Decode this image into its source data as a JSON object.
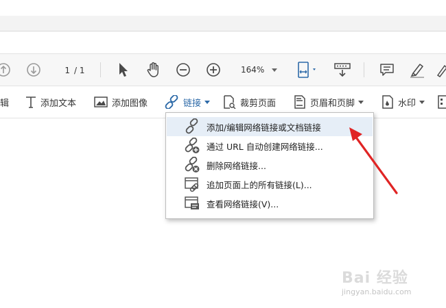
{
  "nav": {
    "page_current": "1",
    "page_total": "/ 1",
    "zoom": "164%"
  },
  "edit_toolbar": {
    "partial_label": "辑",
    "add_text": "添加文本",
    "add_image": "添加图像",
    "link": "链接",
    "crop_page": "裁剪页面",
    "header_footer": "页眉和页脚",
    "watermark": "水印"
  },
  "link_menu": {
    "items": [
      {
        "label": "添加/编辑网络链接或文档链接",
        "icon": "link-edit-icon"
      },
      {
        "label": "通过 URL 自动创建网络链接...",
        "icon": "link-add-icon"
      },
      {
        "label": "删除网络链接...",
        "icon": "link-remove-icon"
      },
      {
        "label": "追加页面上的所有链接(L)...",
        "icon": "append-page-links-icon"
      },
      {
        "label": "查看网络链接(V)...",
        "icon": "view-links-icon"
      }
    ]
  },
  "colors": {
    "accent": "#2d6aa8",
    "highlight": "#e6eef7",
    "annotation_arrow": "#e02424"
  },
  "watermark": {
    "brand": "Bai 经验",
    "url": "jingyan.baidu.com"
  }
}
